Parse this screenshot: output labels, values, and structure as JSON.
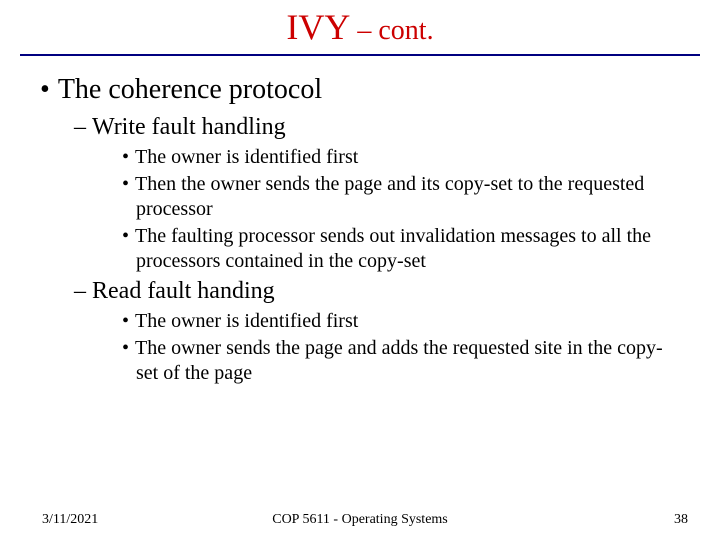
{
  "title": {
    "main": "IVY",
    "suffix": " – cont."
  },
  "content": {
    "b1": "The coherence protocol",
    "sec1": {
      "heading": "Write fault handling",
      "items": [
        "The owner is identified first",
        "Then the owner sends the page and its copy-set to the requested processor",
        "The faulting processor sends out invalidation messages to all the processors contained in the copy-set"
      ]
    },
    "sec2": {
      "heading": "Read fault handing",
      "items": [
        "The owner is identified first",
        "The owner sends the page and adds the requested site in the copy-set of the page"
      ]
    }
  },
  "footer": {
    "date": "3/11/2021",
    "center": "COP 5611 - Operating Systems",
    "page": "38"
  }
}
